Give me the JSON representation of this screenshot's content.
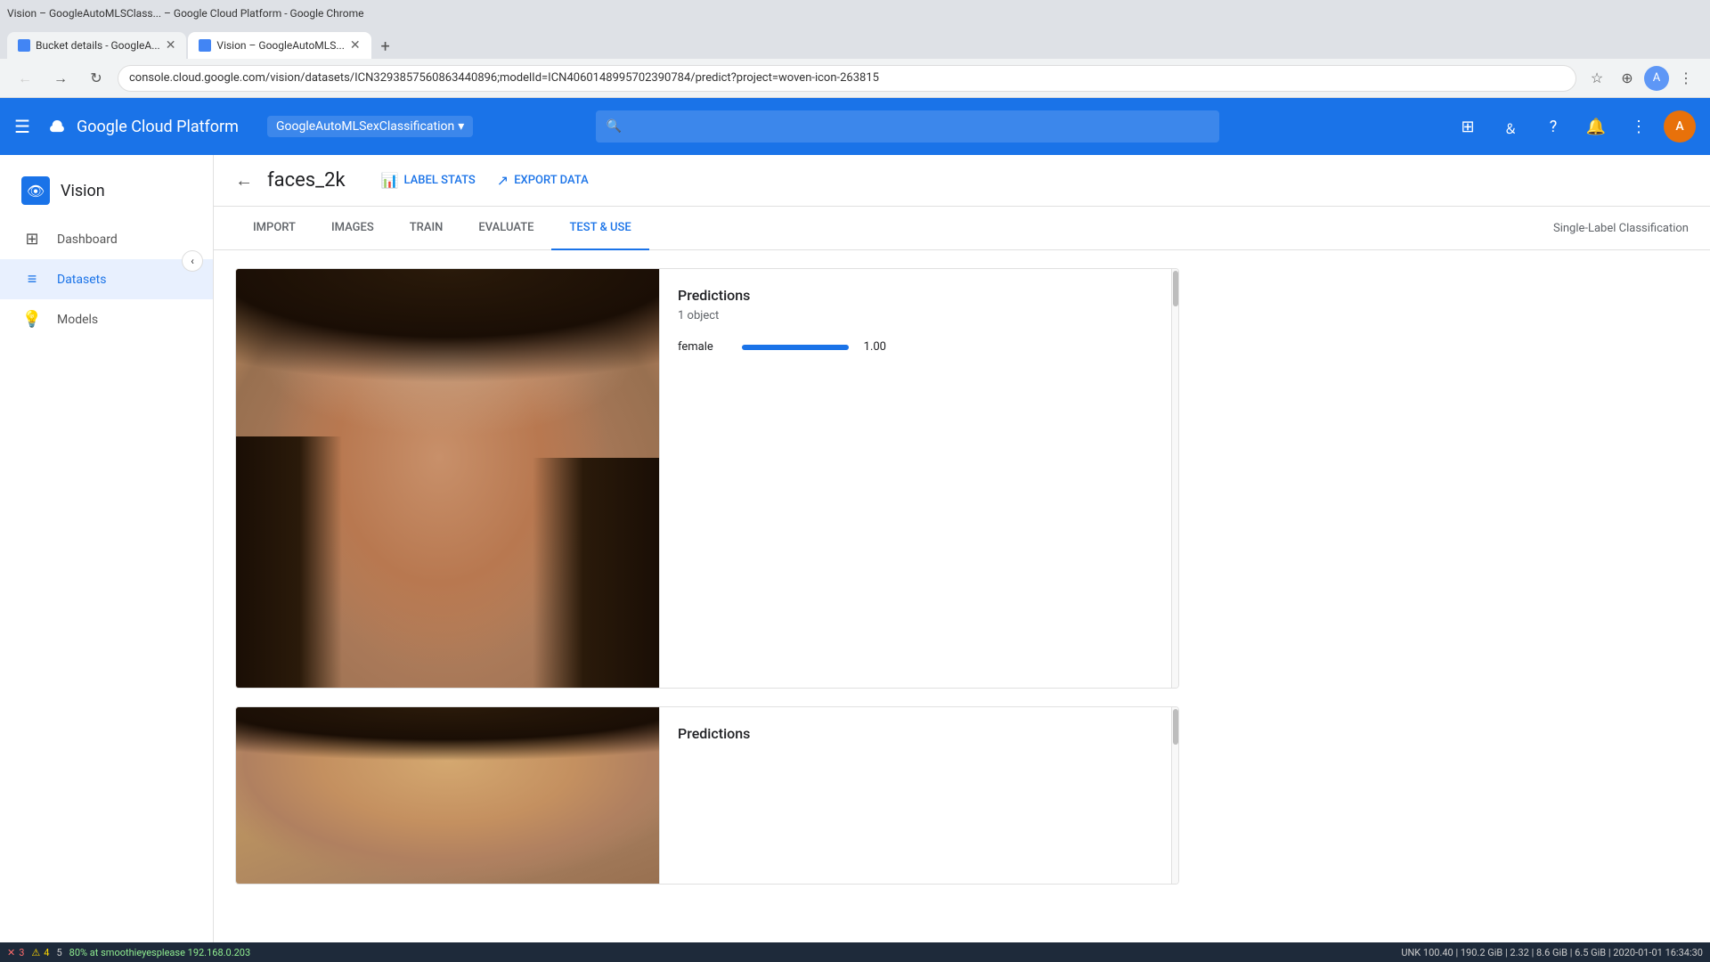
{
  "browser": {
    "titlebar": "Vision – GoogleAutoMLSClass... – Google Cloud Platform - Google Chrome",
    "tabs": [
      {
        "id": "tab1",
        "label": "Bucket details - GoogleA...",
        "active": false
      },
      {
        "id": "tab2",
        "label": "Vision – GoogleAutoMLS...",
        "active": true
      }
    ],
    "address": "console.cloud.google.com/vision/datasets/ICN329385756086344089​6;modelId=ICN4060148995702390784/predict?project=woven-icon-263815"
  },
  "gcp_topnav": {
    "logo_text": "Google Cloud Platform",
    "project": "GoogleAutoMLSexClassification",
    "search_placeholder": "Search",
    "user_initial": "A"
  },
  "sidebar": {
    "product": "Vision",
    "nav_items": [
      {
        "id": "dashboard",
        "label": "Dashboard",
        "active": false
      },
      {
        "id": "datasets",
        "label": "Datasets",
        "active": true
      },
      {
        "id": "models",
        "label": "Models",
        "active": false
      }
    ]
  },
  "dataset": {
    "title": "faces_2k",
    "actions": [
      {
        "id": "label-stats",
        "label": "LABEL STATS"
      },
      {
        "id": "export-data",
        "label": "EXPORT DATA"
      }
    ],
    "tabs": [
      {
        "id": "import",
        "label": "IMPORT"
      },
      {
        "id": "images",
        "label": "IMAGES"
      },
      {
        "id": "train",
        "label": "TRAIN"
      },
      {
        "id": "evaluate",
        "label": "EVALUATE"
      },
      {
        "id": "test-use",
        "label": "TEST & USE",
        "active": true
      }
    ],
    "right_label": "Single-Label Classification"
  },
  "predictions": [
    {
      "id": "pred1",
      "title": "Predictions",
      "count": "1 object",
      "items": [
        {
          "label": "female",
          "bar_pct": 100,
          "value": "1.00"
        }
      ]
    },
    {
      "id": "pred2",
      "title": "Predictions",
      "count": "",
      "items": []
    }
  ],
  "status_bar": {
    "errors": "3",
    "warnings": "4",
    "info": "5",
    "right_text": "UNK 100.40 | 190.2 GiB | 2.32 | 8.6 GiB | 6.5 GiB | 2020-01-01 16:34:30",
    "network": " 80% at smoothieyesplease  192.168.0.203"
  }
}
